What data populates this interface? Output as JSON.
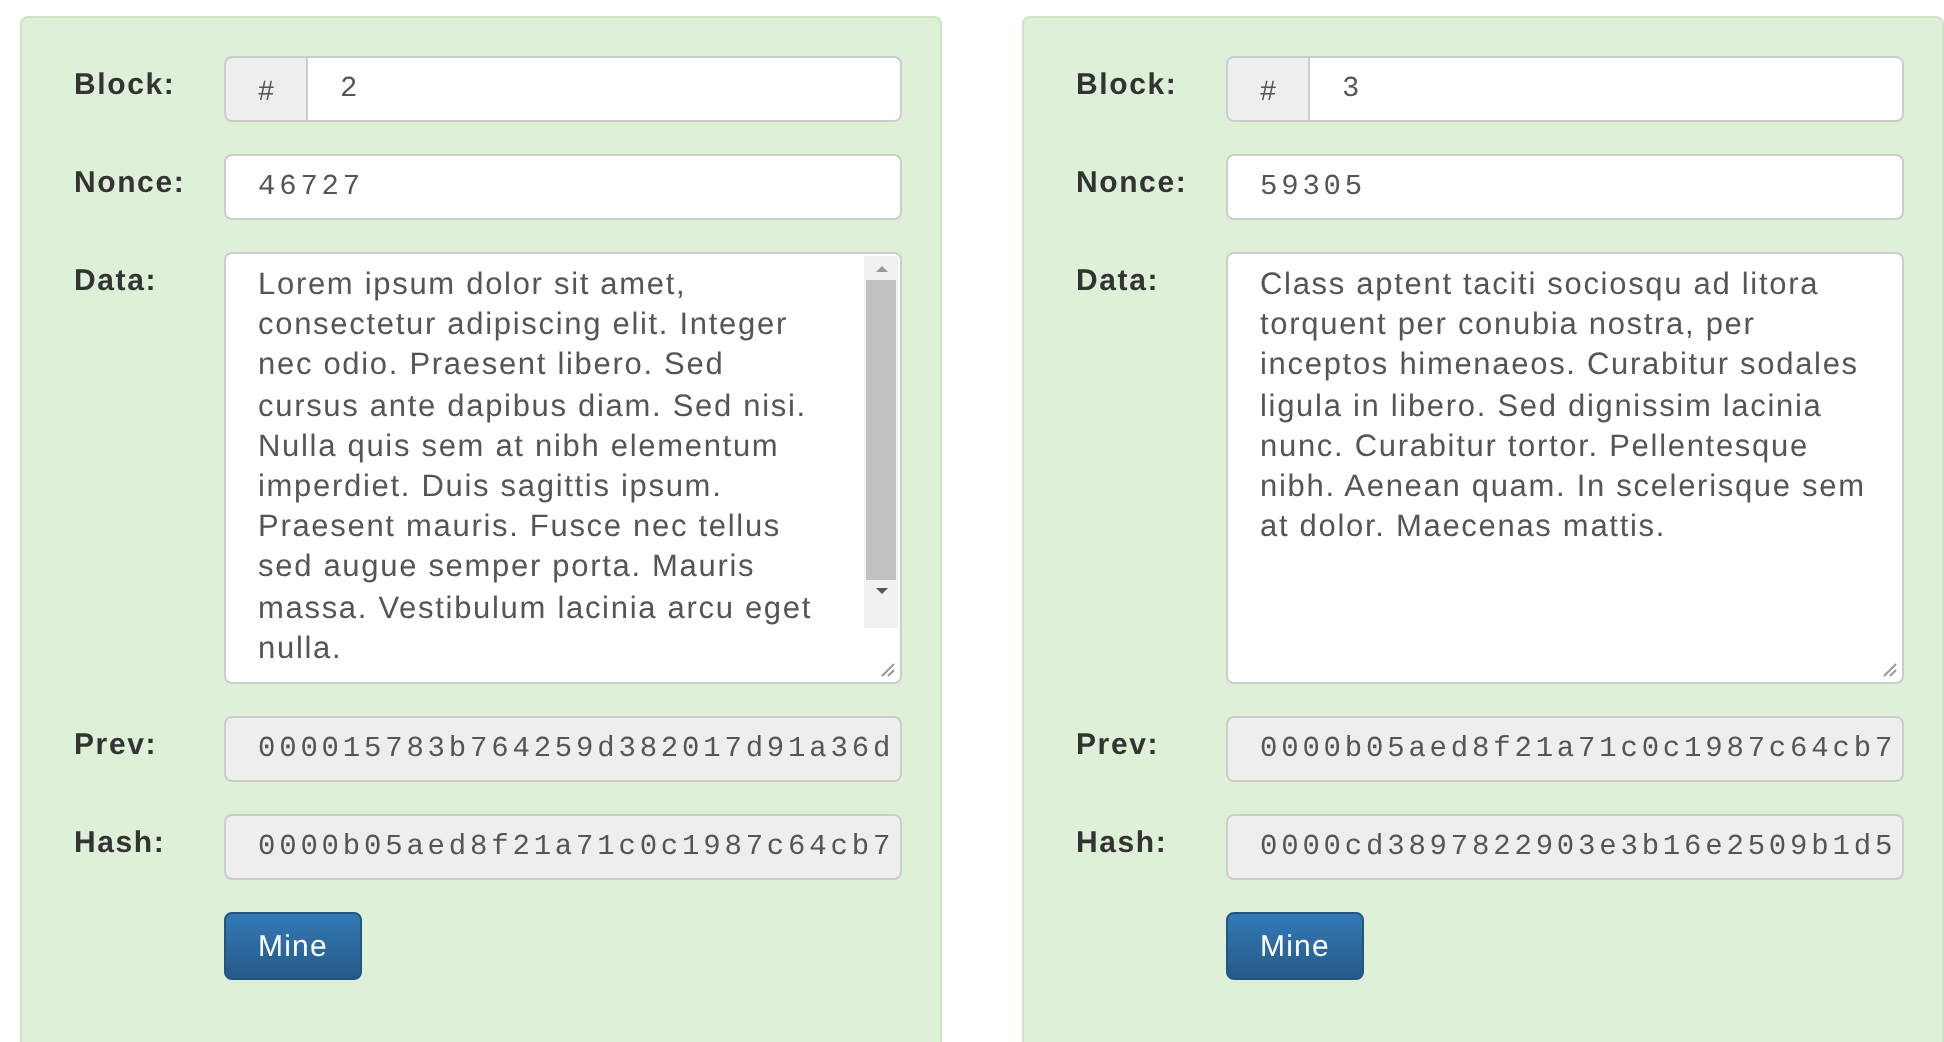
{
  "blocks": [
    {
      "block_label": "Block:",
      "prefix": "#",
      "block": "2",
      "nonce_label": "Nonce:",
      "nonce": "46727",
      "data_label": "Data:",
      "data": "Lorem ipsum dolor sit amet, consectetur adipiscing elit. Integer nec odio. Praesent libero. Sed cursus ante dapibus diam. Sed nisi. Nulla quis sem at nibh elementum imperdiet. Duis sagittis ipsum. Praesent mauris. Fusce nec tellus sed augue semper porta. Mauris massa. Vestibulum lacinia arcu eget nulla.",
      "scrollbar": true,
      "prev_label": "Prev:",
      "prev": "000015783b764259d382017d91a36d",
      "hash_label": "Hash:",
      "hash": "0000b05aed8f21a71c0c1987c64cb7",
      "button": "Mine"
    },
    {
      "block_label": "Block:",
      "prefix": "#",
      "block": "3",
      "nonce_label": "Nonce:",
      "nonce": "59305",
      "data_label": "Data:",
      "data": "Class aptent taciti sociosqu ad litora torquent per conubia nostra, per inceptos himenaeos. Curabitur sodales ligula in libero. Sed dignissim lacinia nunc. Curabitur tortor. Pellentesque nibh. Aenean quam. In scelerisque sem at dolor. Maecenas mattis.",
      "scrollbar": false,
      "prev_label": "Prev:",
      "prev": "0000b05aed8f21a71c0c1987c64cb7",
      "hash_label": "Hash:",
      "hash": "0000cd3897822903e3b16e2509b1d5",
      "button": "Mine"
    }
  ]
}
